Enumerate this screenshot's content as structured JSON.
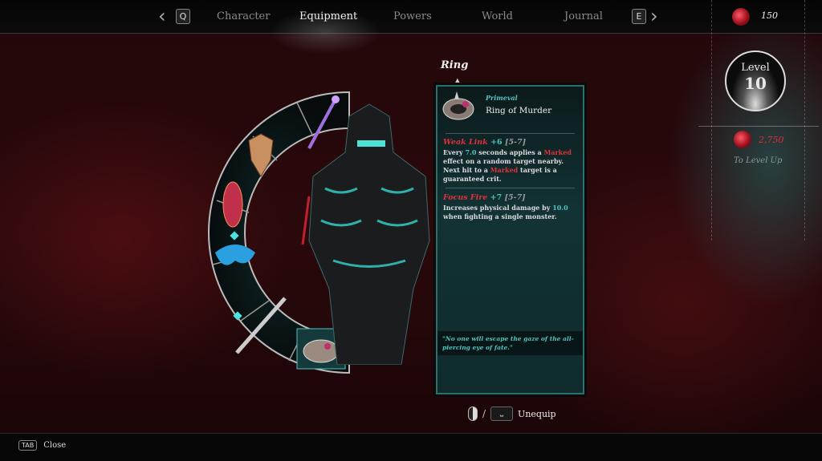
{
  "nav": {
    "prev_key": "Q",
    "next_key": "E",
    "tabs": [
      {
        "label": "Character"
      },
      {
        "label": "Equipment",
        "active": true
      },
      {
        "label": "Powers"
      },
      {
        "label": "World"
      },
      {
        "label": "Journal"
      }
    ]
  },
  "currency": {
    "amount": "150",
    "icon": "blood-gem-icon"
  },
  "level": {
    "label": "Level",
    "value": "10",
    "to_level_amount": "2,750",
    "to_level_label": "To Level Up"
  },
  "slot_label": "Ring",
  "item": {
    "rarity": "Primeval",
    "name": "Ring of Murder",
    "affixes": [
      {
        "name": "Weak Link",
        "bonus": "+6",
        "range": "[5-7]",
        "desc_parts": [
          "Every ",
          "7.0",
          " seconds applies a ",
          "Marked",
          " effect on a random target nearby. Next hit to a ",
          "Marked",
          " target is a guaranteed crit."
        ]
      },
      {
        "name": "Focus Fire",
        "bonus": "+7",
        "range": "[5-7]",
        "desc_parts": [
          "Increases physical damage by ",
          "10.0",
          " when fighting a single monster."
        ]
      }
    ],
    "flavor": "\"No one will escape the gaze of the all-piercing eye of fate.\""
  },
  "actions": {
    "separator": "/",
    "unequip_label": "Unequip",
    "close_key": "TAB",
    "close_label": "Close"
  },
  "colors": {
    "accent_teal": "#4fc4c0",
    "affix_red": "#e0303a",
    "panel_border": "#2d6f6a"
  }
}
